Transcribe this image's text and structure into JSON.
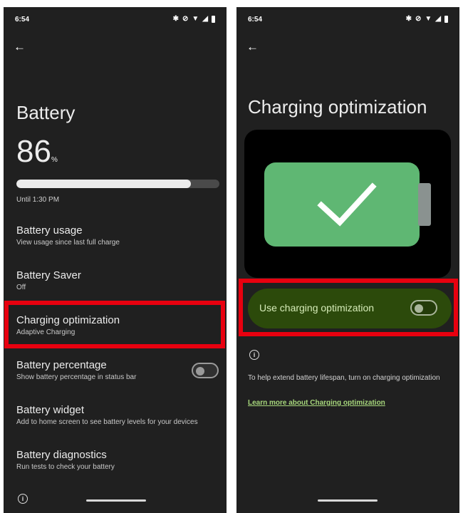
{
  "left": {
    "status_time": "6:54",
    "title": "Battery",
    "percent": "86",
    "percent_unit": "%",
    "level_fraction": 0.86,
    "until": "Until 1:30 PM",
    "items": [
      {
        "title": "Battery usage",
        "subtitle": "View usage since last full charge"
      },
      {
        "title": "Battery Saver",
        "subtitle": "Off"
      },
      {
        "title": "Charging optimization",
        "subtitle": "Adaptive Charging"
      },
      {
        "title": "Battery percentage",
        "subtitle": "Show battery percentage in status bar"
      },
      {
        "title": "Battery widget",
        "subtitle": "Add to home screen to see battery levels for your devices"
      },
      {
        "title": "Battery diagnostics",
        "subtitle": "Run tests to check your battery"
      }
    ]
  },
  "right": {
    "status_time": "6:54",
    "title": "Charging optimization",
    "toggle_label": "Use charging optimization",
    "help_text": "To help extend battery lifespan, turn on charging optimization",
    "learn_more": "Learn more about Charging optimization"
  },
  "colors": {
    "highlight": "#e8000f",
    "battery_green": "#5fb773",
    "option_bg": "#2c4a0b",
    "link": "#a7d77c"
  },
  "icons": {
    "bluetooth": "bluetooth-icon",
    "vibrate_off": "vibrate-off-icon",
    "wifi": "wifi-icon",
    "signal": "signal-icon",
    "battery": "battery-icon",
    "back": "back-arrow-icon",
    "info": "info-icon",
    "check": "check-icon"
  }
}
